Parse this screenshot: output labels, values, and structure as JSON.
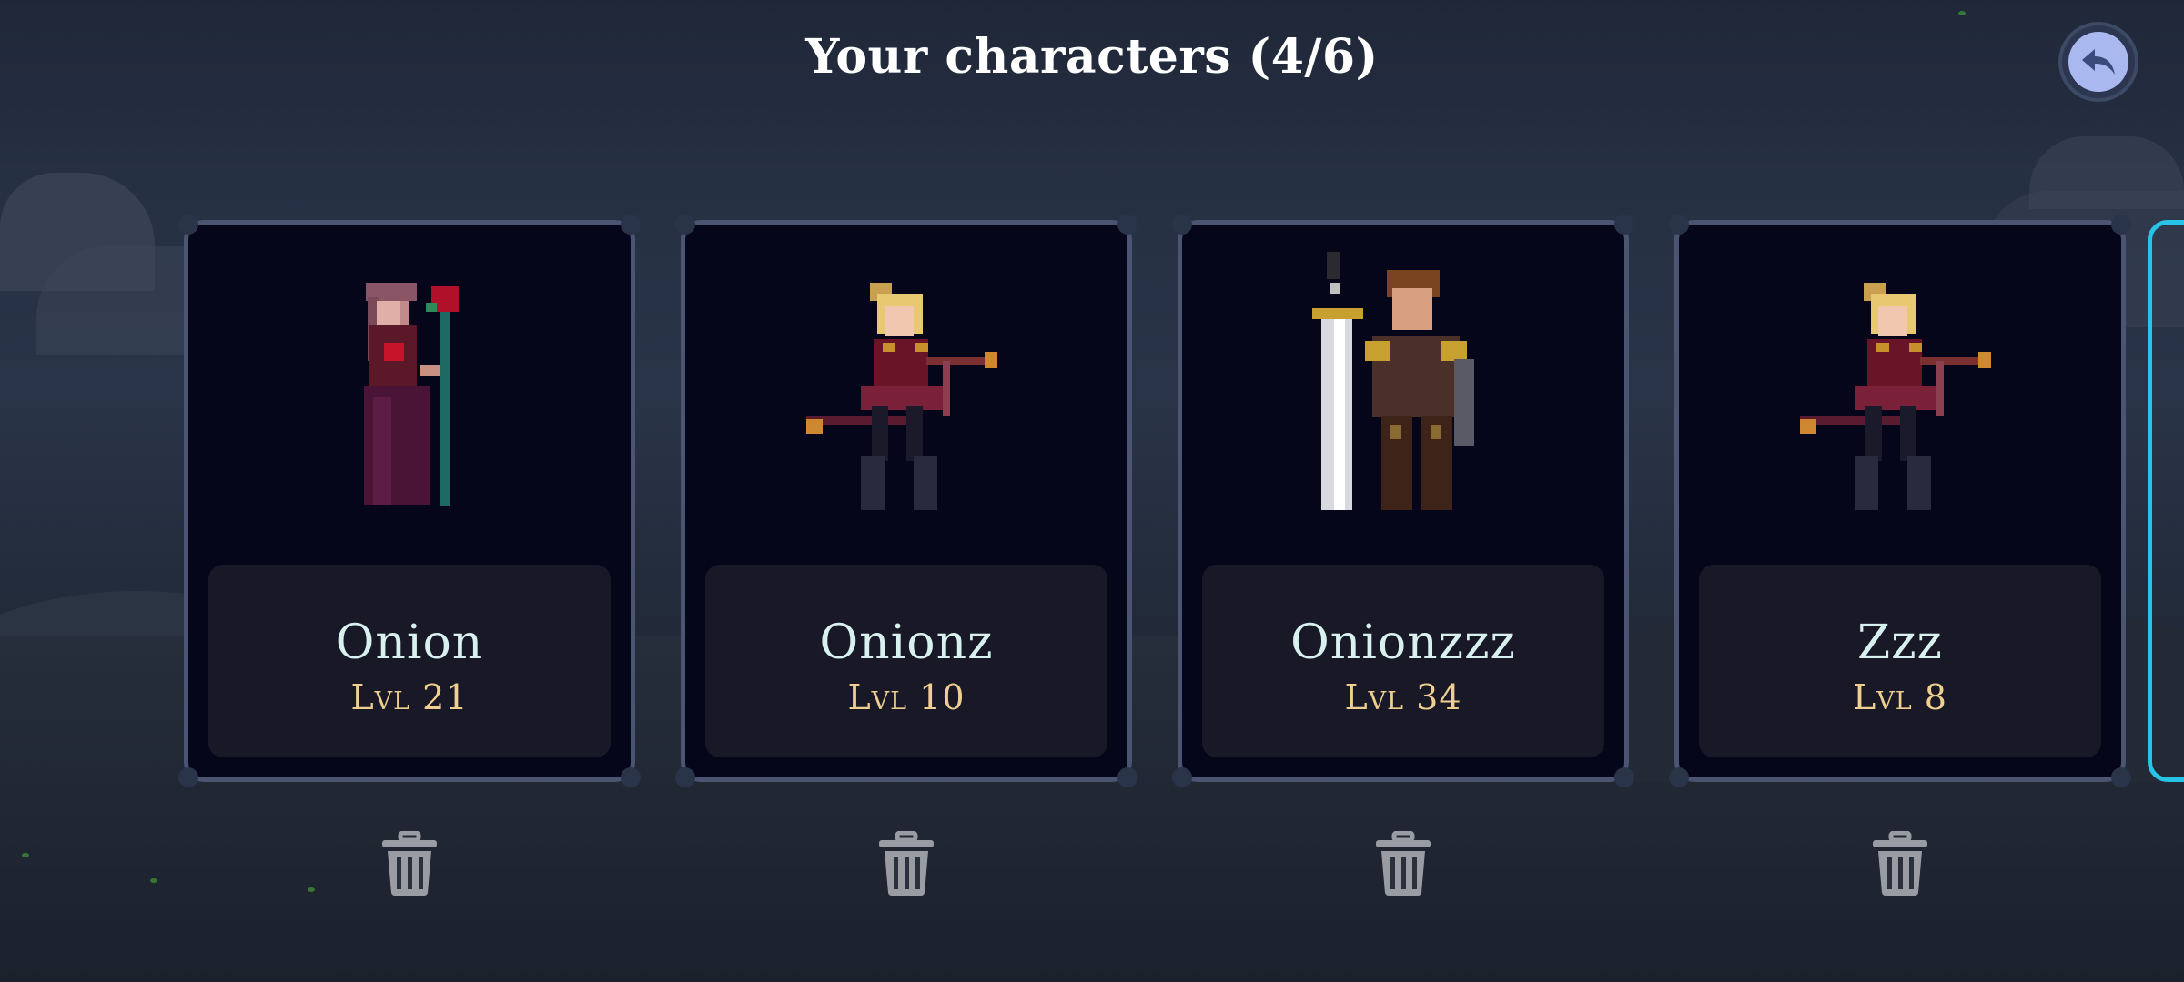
{
  "title": "Your characters (4/6)",
  "back_button": {
    "icon": "back-arrow-icon"
  },
  "characters": [
    {
      "name": "Onion",
      "level": "Lvl 21",
      "portrait": "mage-woman-icon"
    },
    {
      "name": "Onionz",
      "level": "Lvl 10",
      "portrait": "archer-girl-icon"
    },
    {
      "name": "Onionzzz",
      "level": "Lvl 34",
      "portrait": "swordsman-icon"
    },
    {
      "name": "Zzz",
      "level": "Lvl 8",
      "portrait": "archer-girl-icon"
    }
  ],
  "delete_icon": "trash-icon",
  "colors": {
    "card_border": "#4b5571",
    "card_bg": "#05061a",
    "name_text": "#d8f1ef",
    "level_text": "#efcf8f",
    "highlight_border": "#27c4e8",
    "back_button": "#aab8f0"
  }
}
